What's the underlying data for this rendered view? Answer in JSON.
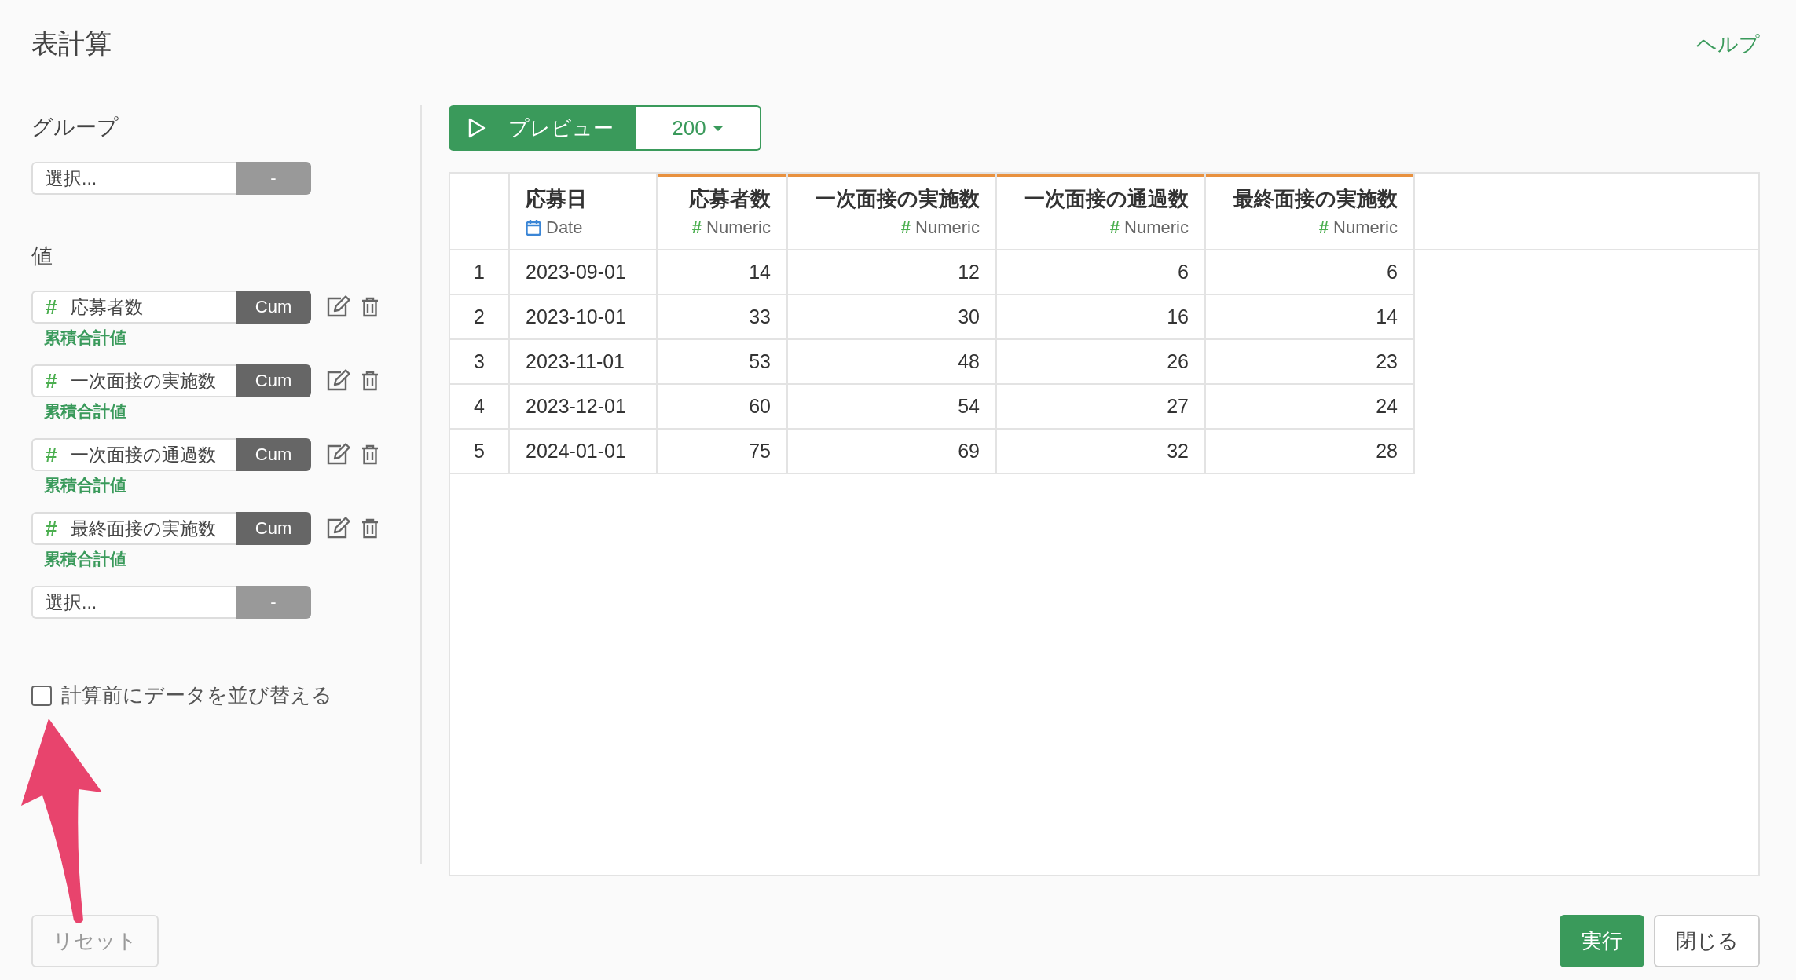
{
  "title": "表計算",
  "help": "ヘルプ",
  "group": {
    "label": "グループ",
    "select": {
      "placeholder": "選択...",
      "button": "-"
    }
  },
  "values": {
    "label": "値",
    "items": [
      {
        "mark": "#",
        "column": "応募者数",
        "function": "Cum",
        "caption": "累積合計値"
      },
      {
        "mark": "#",
        "column": "一次面接の実施数",
        "function": "Cum",
        "caption": "累積合計値"
      },
      {
        "mark": "#",
        "column": "一次面接の通過数",
        "function": "Cum",
        "caption": "累積合計値"
      },
      {
        "mark": "#",
        "column": "最終面接の実施数",
        "function": "Cum",
        "caption": "累積合計値"
      }
    ],
    "select": {
      "placeholder": "選択...",
      "button": "-"
    }
  },
  "sort_option": {
    "label": "計算前にデータを並び替える",
    "checked": false
  },
  "preview": {
    "button": "プレビュー",
    "count": "200"
  },
  "table": {
    "columns": [
      {
        "name": "応募日",
        "kind": "date",
        "type": "Date",
        "highlighted": false
      },
      {
        "name": "応募者数",
        "kind": "numeric",
        "mark": "#",
        "type": "Numeric",
        "highlighted": true
      },
      {
        "name": "一次面接の実施数",
        "kind": "numeric",
        "mark": "#",
        "type": "Numeric",
        "highlighted": true
      },
      {
        "name": "一次面接の通過数",
        "kind": "numeric",
        "mark": "#",
        "type": "Numeric",
        "highlighted": true
      },
      {
        "name": "最終面接の実施数",
        "kind": "numeric",
        "mark": "#",
        "type": "Numeric",
        "highlighted": true
      }
    ],
    "rows": [
      {
        "index": "1",
        "cells": [
          "2023-09-01",
          "14",
          "12",
          "6",
          "6"
        ]
      },
      {
        "index": "2",
        "cells": [
          "2023-10-01",
          "33",
          "30",
          "16",
          "14"
        ]
      },
      {
        "index": "3",
        "cells": [
          "2023-11-01",
          "53",
          "48",
          "26",
          "23"
        ]
      },
      {
        "index": "4",
        "cells": [
          "2023-12-01",
          "60",
          "54",
          "27",
          "24"
        ]
      },
      {
        "index": "5",
        "cells": [
          "2024-01-01",
          "75",
          "69",
          "32",
          "28"
        ]
      }
    ]
  },
  "footer": {
    "reset": "リセット",
    "run": "実行",
    "close": "閉じる"
  }
}
